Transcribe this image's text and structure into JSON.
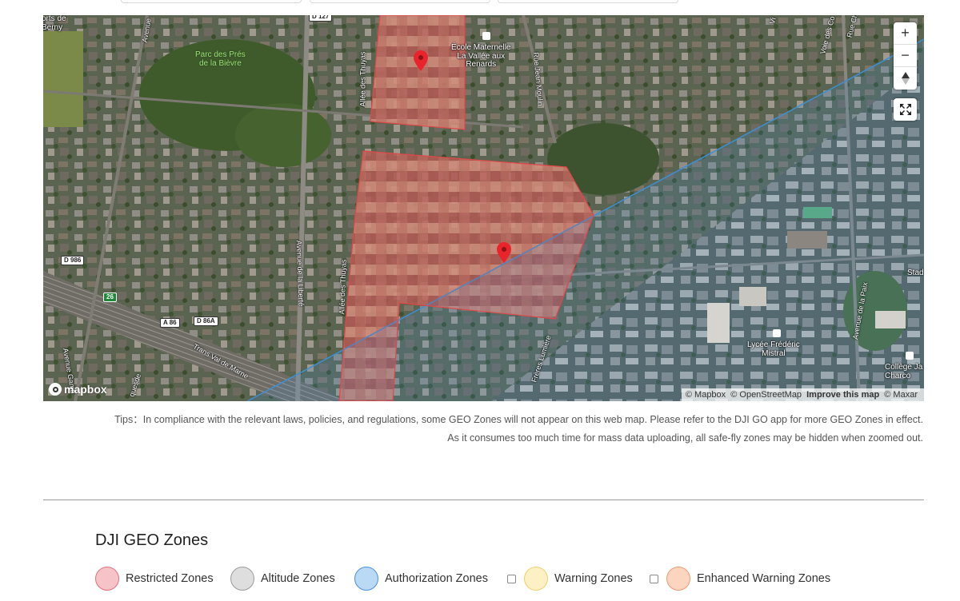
{
  "map": {
    "labels": {
      "top_left_town": "orts de\nBerny",
      "park": "Parc des Prés\nde la Bièvre",
      "school": "École Maternelle\nLa Vallée aux\nRenards",
      "lycee": "Lycée Frédéric\nMistral",
      "college": "Collège Ja\nCharco",
      "stad": "Stad"
    },
    "roads": {
      "avenue_top": "Avenue",
      "allee_thuyas_1": "Allée des Thuyas",
      "allee_thuyas_2": "Allée des Thuyas",
      "rue_jean_moulin": "Rue Jean Moulin",
      "avenue_liberte": "Avenue de la Liberté",
      "trans_val_de_marne": "Trans Val de Marne",
      "freres_lumiere": "Frères Lumière",
      "avenue_paix": "Avenue de la Paix",
      "voie_des_co": "Voie des Co",
      "rue_ch": "Rue Ch",
      "vi": "Vi",
      "avenue_gamb": "Avenue Gamb",
      "quesde": "quesde"
    },
    "shields": {
      "d127": "D 127",
      "d986": "D 986",
      "n26": "26",
      "a86": "A 86",
      "d86a": "D 86A"
    },
    "zoom_in_label": "+",
    "zoom_out_label": "−",
    "compass_label": "▲",
    "fullscreen_icon": "fullscreen-icon",
    "logo_text": "mapbox",
    "attribution": {
      "mapbox": "© Mapbox",
      "osm": "© OpenStreetMap",
      "improve": "Improve this map",
      "maxar": "© Maxar"
    },
    "zone_colors": {
      "restricted": "#d94a4a",
      "authorization": "#3d8fd6"
    }
  },
  "tips": {
    "line1": "Tips：In compliance with the relevant laws, policies, and regulations, some GEO Zones will not appear on this web map. Please refer to the DJI GO app for more GEO Zones in effect.",
    "line2": "As it consumes too much time for mass data uploading, all safe-fly zones may be hidden when zoomed out."
  },
  "geo_zones": {
    "title": "DJI GEO Zones",
    "items": [
      {
        "label": "Restricted Zones",
        "fill": "#f6c4c8",
        "border": "#e0707a",
        "has_checkbox": false
      },
      {
        "label": "Altitude Zones",
        "fill": "#dedede",
        "border": "#9a9a9a",
        "has_checkbox": false
      },
      {
        "label": "Authorization Zones",
        "fill": "#b9d9f5",
        "border": "#4a90d9",
        "has_checkbox": false
      },
      {
        "label": "Warning Zones",
        "fill": "#fdf0c4",
        "border": "#f1cf6e",
        "has_checkbox": true
      },
      {
        "label": "Enhanced Warning Zones",
        "fill": "#fbd5c0",
        "border": "#ee9a70",
        "has_checkbox": true
      }
    ]
  }
}
